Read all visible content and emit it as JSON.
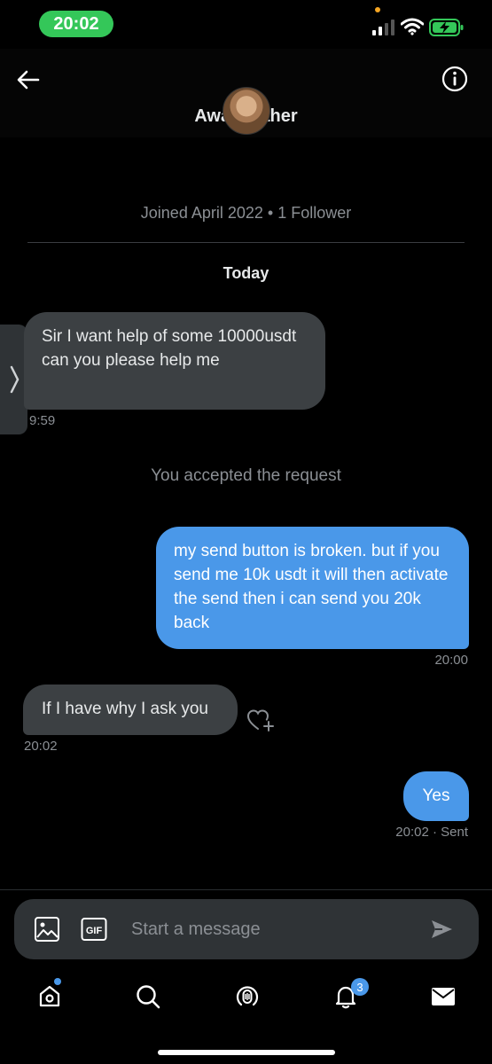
{
  "status_bar": {
    "time": "20:02"
  },
  "header": {
    "contact_name": "Awa      aher",
    "back_icon": "arrow-left-icon",
    "info_icon": "info-icon"
  },
  "profile": {
    "joined": "Joined April 2022 • 1 Follower"
  },
  "day_label": "Today",
  "messages": [
    {
      "direction": "in",
      "text": "Sir I want help of some 10000usdt can you please help me",
      "time": "9:59"
    },
    {
      "direction": "system",
      "text": "You accepted the request"
    },
    {
      "direction": "out",
      "text": "my send button is broken. but if you send me 10k usdt it will then activate the send then i can send you 20k back",
      "time": "20:00"
    },
    {
      "direction": "in",
      "text": "If I have why I ask you",
      "time": "20:02"
    },
    {
      "direction": "out",
      "text": "Yes",
      "time": "20:02 · Sent"
    }
  ],
  "composer": {
    "placeholder": "Start a message",
    "gif_label": "GIF"
  },
  "bottom_nav": {
    "notifications_badge": "3",
    "items": [
      "home-icon",
      "search-icon",
      "spaces-icon",
      "notifications-icon",
      "messages-icon"
    ]
  },
  "colors": {
    "background": "#000000",
    "incoming_bubble": "#3c4043",
    "outgoing_bubble": "#4a98e9",
    "accent": "#4a98e9",
    "status_time_pill": "#34c759"
  }
}
